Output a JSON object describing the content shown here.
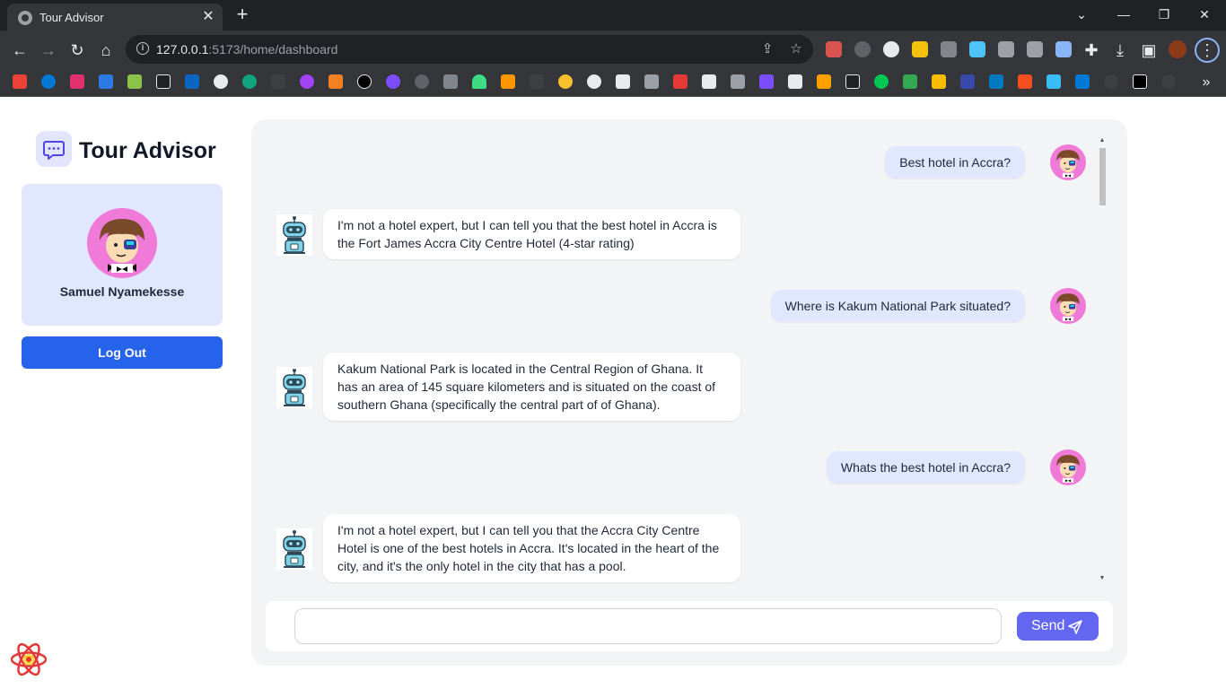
{
  "browser": {
    "tab_title": "Tour Advisor",
    "url_host": "127.0.0.1",
    "url_rest": ":5173/home/dashboard"
  },
  "app": {
    "brand_title": "Tour Advisor",
    "user_name": "Samuel Nyamekesse",
    "logout_label": "Log Out",
    "send_label": "Send",
    "input_value": ""
  },
  "messages": [
    {
      "role": "user",
      "text": "Best hotel in Accra?"
    },
    {
      "role": "bot",
      "text": "I'm not a hotel expert, but I can tell you that the best hotel in Accra is the Fort James Accra City Centre Hotel (4-star rating)"
    },
    {
      "role": "user",
      "text": "Where is Kakum National Park situated?"
    },
    {
      "role": "bot",
      "text": "Kakum National Park is located in the Central Region of Ghana. It has an area of 145 square kilometers and is situated on the coast of southern Ghana (specifically the central part of of Ghana)."
    },
    {
      "role": "user",
      "text": "Whats the best hotel in Accra?"
    },
    {
      "role": "bot",
      "text": "I'm not a hotel expert, but I can tell you that the Accra City Centre Hotel is one of the best hotels in Accra. It's located in the heart of the city, and it's the only hotel in the city that has a pool."
    }
  ],
  "colors": {
    "primary": "#2563eb",
    "send": "#6366f1",
    "user_bubble": "#e0e7ff",
    "panel": "#f3f4f6"
  }
}
